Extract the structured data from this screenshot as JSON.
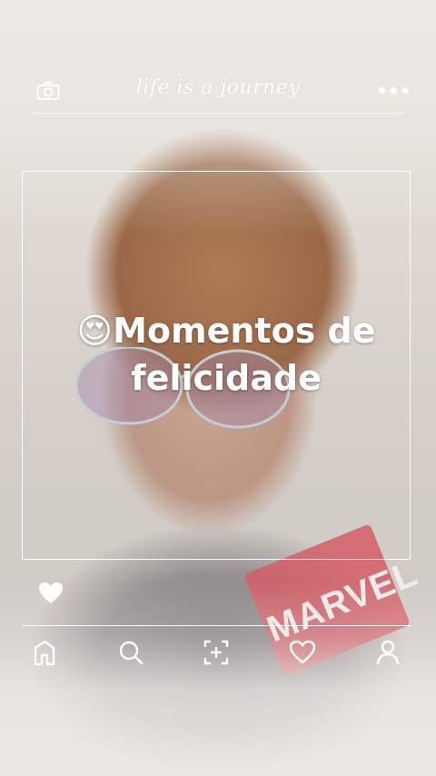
{
  "header": {
    "slogan": "life is a journey",
    "camera_icon": "camera-icon",
    "more_icon": "more-options-icon",
    "more_glyph": "•••"
  },
  "post": {
    "caption_emoji": "😍",
    "caption_text": "Momentos de felicidade",
    "like_icon": "heart-icon"
  },
  "nav": {
    "items": [
      "home-icon",
      "search-icon",
      "add-post-icon",
      "activity-heart-icon",
      "profile-icon"
    ]
  },
  "colors": {
    "overlay_line": "#ffffff",
    "hair": "#8e5632",
    "marvel_red": "#d04a55"
  }
}
